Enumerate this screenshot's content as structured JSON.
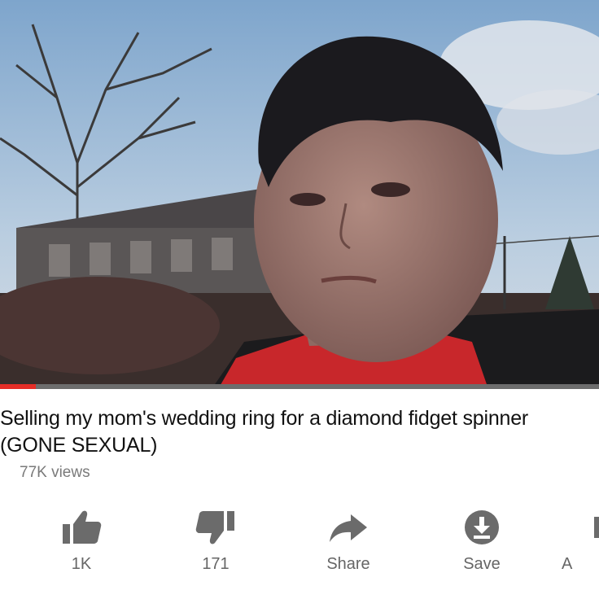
{
  "video": {
    "progress": 0.06,
    "colors": {
      "progress_played": "#e52d27",
      "progress_track": "#6d6d6d"
    }
  },
  "title": "Selling my mom's wedding ring for a diamond fidget spinner (GONE SEXUAL)",
  "views": "77K views",
  "actions": {
    "like": {
      "label": "1K",
      "icon": "thumbs-up-icon"
    },
    "dislike": {
      "label": "171",
      "icon": "thumbs-down-icon"
    },
    "share": {
      "label": "Share",
      "icon": "share-arrow-icon"
    },
    "save": {
      "label": "Save",
      "icon": "download-icon"
    },
    "add": {
      "label": "A",
      "icon": "add-to-playlist-icon"
    }
  }
}
